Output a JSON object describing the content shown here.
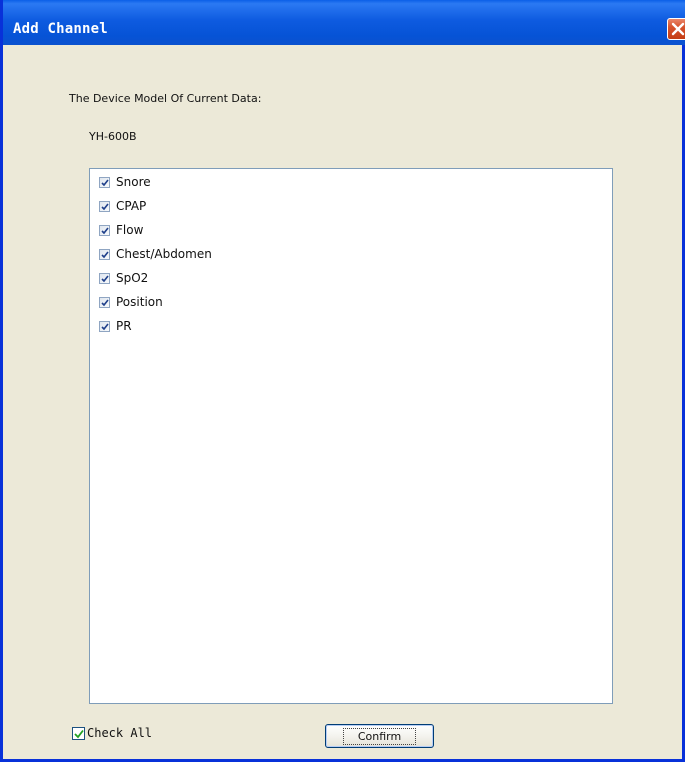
{
  "window": {
    "title": "Add Channel",
    "close_icon": "close-icon"
  },
  "device": {
    "label": "The Device Model Of Current Data:",
    "model": "YH-600B"
  },
  "channels": [
    {
      "label": "Snore",
      "checked": true
    },
    {
      "label": "CPAP",
      "checked": true
    },
    {
      "label": "Flow",
      "checked": true
    },
    {
      "label": "Chest/Abdomen",
      "checked": true
    },
    {
      "label": "SpO2",
      "checked": true
    },
    {
      "label": "Position",
      "checked": true
    },
    {
      "label": "PR",
      "checked": true
    }
  ],
  "footer": {
    "check_all_label": "Check All",
    "check_all_checked": true,
    "confirm_label": "Confirm"
  },
  "colors": {
    "titlebar": "#0653d6",
    "close_button": "#d7532d",
    "dialog_bg": "#ece9d8",
    "check_all_tick": "#21a121"
  }
}
